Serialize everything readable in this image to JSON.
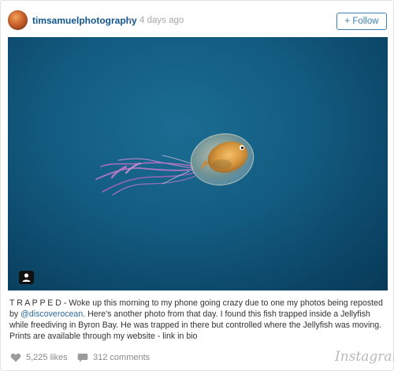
{
  "post": {
    "username": "timsamuelphotography",
    "separator": "•",
    "time": "4 days ago",
    "follow_label": "+ Follow"
  },
  "caption": {
    "before": "T R A P P E D - Woke up this morning to my phone going crazy due to one my photos being reposted by ",
    "mention": "@discoverocean",
    "after": ". Here's another photo from that day. I found this fish trapped inside a Jellyfish while freediving in Byron Bay. He was trapped in there but controlled where the Jellyfish was moving. Prints are available through my website - link in bio"
  },
  "footer": {
    "likes": "5,225 likes",
    "comments": "312 comments",
    "brand": "Instagram"
  },
  "icons": {
    "like": "heart-icon",
    "comment": "comment-bubble-icon",
    "user_tag": "user-tag-icon"
  },
  "colors": {
    "username": "#12568f",
    "follow": "#3b7fb6",
    "water": "#135b80"
  }
}
